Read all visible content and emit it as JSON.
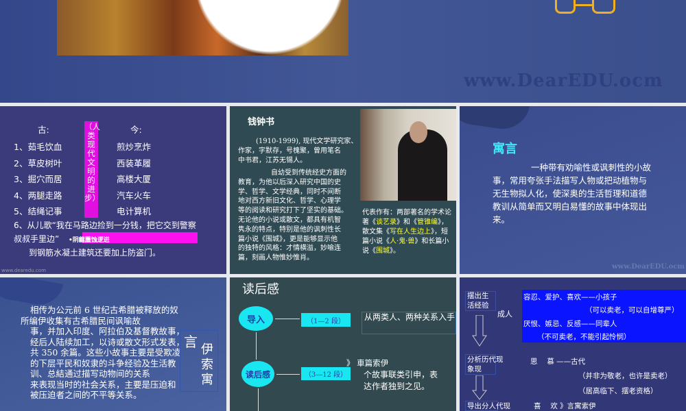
{
  "slide0": {
    "watermark": "www.DearEDU.ocm"
  },
  "slide1": {
    "ancient_label": "古:",
    "modern_label": "今:",
    "ancient": [
      "1、茹毛饮血",
      "2、草皮树叶",
      "3、掘穴而居",
      "4、两腿走路",
      "5、结绳记事"
    ],
    "modern": [
      "煎炒烹炸",
      "西装革履",
      "高楼大厦",
      "汽车火车",
      "电计算机"
    ],
    "vertical_banner": "（人类现代文明的进步）",
    "item6_line1": "6、从儿歌“我在马路边捡到一分钱，把它交到警察",
    "item6_line2": "叔叔手里边”",
    "overlay_banner": "•阴龤蘪蚀逻逬",
    "item6_line3": "到钢筋水凝土建筑还要加上防盗门。",
    "watermark": "www.dearedu.com"
  },
  "slide2": {
    "title": "钱钟书",
    "para1": [
      "(1910-1999), 现代文学研究家、",
      "作家，字默存，号槐聚，曾用笔名",
      "中书君，江苏无锡人。"
    ],
    "para2": [
      "自幼受到传统经史方面的",
      "教育，为他以后深入研究中国的史",
      "学、哲学、文学经典，同时不间断",
      "地对西方新旧文化、哲学、心理学",
      "等的阅读和研究打下了坚实的基础。",
      "无论他的小说或散文，都具有机智",
      "隽永的特点，特别是他的讽刺性长",
      "篇小说《围城》，更是能够显示他",
      "的独特的风格：才情横溢，妙喻连",
      "篇，刻画人物惟妙惟肖。"
    ],
    "works": {
      "t1": "代表作有：两部著名的学",
      "t2": "术论著《",
      "w1": "谈艺录",
      "t3": "》和《",
      "w2a": "管",
      "w2b": "锥编",
      "t4": "》，散文集《",
      "w3a": "写在人",
      "w3b": "生边上",
      "t5": "》，短篇小说《",
      "w4a": "人·",
      "w4b": "鬼·兽",
      "t6": "》和长篇小说《",
      "w5a": "围",
      "w5b": "城",
      "t7": "》。"
    }
  },
  "slide3": {
    "title": "寓言",
    "body": "一种带有劝喻性或讽刺性的小故事，常用夸张手法描写人物或把动植物与无生物拟人化，使深奥的生活哲理和道德教训从简单而又明白易懂的故事中体现出来。",
    "watermark": "www.DearEDU.ocm"
  },
  "slide4": {
    "lines": [
      "相传为公元前 6 世纪古希腊被释放的奴",
      "所编伊收集有古希腊民间讽喻故",
      "事，并加入印度、阿拉伯及基督教故事，",
      "经后人陆续加工，以诗或散文形式发表，",
      "共 350 余篇。这些小故事主要是受欺凌",
      "的下层平民和奴隶的斗争经验及生活教",
      "训、总結通过描写动物间的关系",
      "来表现当时的社会关系，主要是压迫和",
      "被压迫者之间的不平等关系。"
    ],
    "side_char": "言",
    "side_vertical": "伊索寓"
  },
  "slide5": {
    "title": "读后感",
    "node1": "导入",
    "node1_range": "（1—2 段）",
    "node1_text": "从两类人、两种关系入手",
    "node2": "读后感",
    "node2_range": "（3—12 段）",
    "node2_head": "》 車篇索伊",
    "node2_text": [
      "个故事联类引申，表",
      "达作者独到之见。"
    ]
  },
  "slide6": {
    "box1": "摆出生活经验",
    "adult": "成人",
    "blue_lines": [
      "容忍、爱护、喜欢——小孩子",
      "（可以卖老，可以自增尊严）",
      "厌恨、嫉忌、反感——同辈人",
      "（不可卖老，不能引起怜悯）"
    ],
    "box2": "分析历代现象现",
    "row2": "思　 慕 ——古代",
    "row2_a": "（并非为敬老，也许是卖老）",
    "row2_b": "（居高临下、摆老资格）",
    "box3": "导出分人代现",
    "row3": "喜　 欢 》言寓索伊"
  },
  "colors": {
    "magenta": "#ff00ff",
    "cyan": "#19e6f0",
    "blue_panel": "#0a14ff",
    "highlight": "#ffff33",
    "logo": "#f0b020"
  }
}
